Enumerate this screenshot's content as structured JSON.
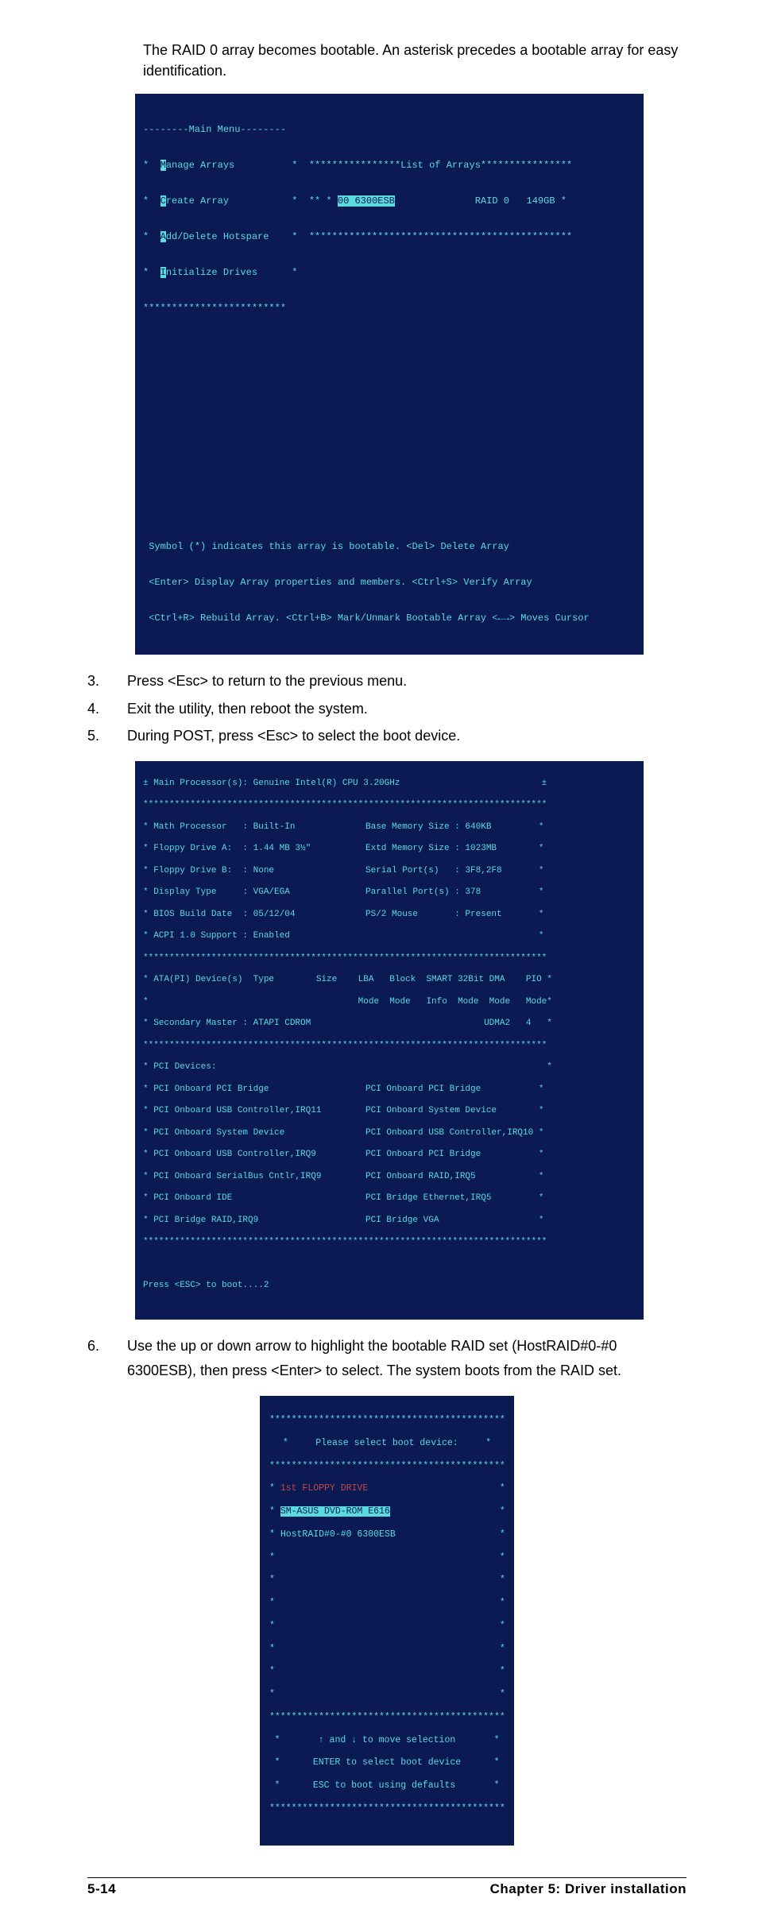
{
  "intro": "The RAID 0 array becomes bootable. An asterisk precedes a bootable array for easy identification.",
  "terminal1": {
    "menu_header": "--------Main Menu--------",
    "menu_items": [
      "anage Arrays",
      "reate Array",
      "dd/Delete Hotspare",
      "nitialize Drives"
    ],
    "menu_hl_chars": [
      "M",
      "C",
      "A",
      "I"
    ],
    "list_header": "****************List of Arrays****************",
    "list_row_prefix": "** * ",
    "list_row_id": "00 6300ESB",
    "list_row_type": "RAID 0",
    "list_row_size": "149GB",
    "list_row_suffix": " *",
    "hint1": "Symbol (*) indicates this array is bootable. <Del> Delete Array",
    "hint2": "<Enter> Display Array properties and members. <Ctrl+S> Verify Array",
    "hint3": "<Ctrl+R> Rebuild Array. <Ctrl+B> Mark/Unmark Bootable Array <←→> Moves Cursor"
  },
  "steps_a": [
    {
      "n": "3.",
      "t": "Press <Esc> to return to the previous menu."
    },
    {
      "n": "4.",
      "t": "Exit the utility, then reboot the system."
    },
    {
      "n": "5.",
      "t": "During POST, press <Esc> to select the boot device."
    }
  ],
  "terminal2": {
    "title": "± Main Processor(s): Genuine Intel(R) CPU 3.20GHz                           ±",
    "divider": "*****************************************************************************",
    "left1": [
      "* Math Processor   : Built-In",
      "* Floppy Drive A:  : 1.44 MB 3½\"",
      "* Floppy Drive B:  : None",
      "* Display Type     : VGA/EGA",
      "* BIOS Build Date  : 05/12/04",
      "* ACPI 1.0 Support : Enabled"
    ],
    "right1": [
      "Base Memory Size : 640KB         *",
      "Extd Memory Size : 1023MB        *",
      "Serial Port(s)   : 3F8,2F8       *",
      "Parallel Port(s) : 378           *",
      "PS/2 Mouse       : Present       *",
      "                                 *"
    ],
    "ata_header": "* ATA(PI) Device(s)  Type        Size    LBA   Block  SMART 32Bit DMA    PIO *",
    "ata_sub": "*                                        Mode  Mode   Info  Mode  Mode   Mode*",
    "ata_row": "* Secondary Master : ATAPI CDROM                                 UDMA2   4   *",
    "pci_header": "* PCI Devices:                                                               *",
    "pci_left": [
      "* PCI Onboard PCI Bridge",
      "* PCI Onboard USB Controller,IRQ11",
      "* PCI Onboard System Device",
      "* PCI Onboard USB Controller,IRQ9",
      "* PCI Onboard SerialBus Cntlr,IRQ9",
      "* PCI Onboard IDE",
      "* PCI Bridge RAID,IRQ9"
    ],
    "pci_right": [
      "PCI Onboard PCI Bridge           *",
      "PCI Onboard System Device        *",
      "PCI Onboard USB Controller,IRQ10 *",
      "PCI Onboard PCI Bridge           *",
      "PCI Onboard RAID,IRQ5            *",
      "PCI Bridge Ethernet,IRQ5         *",
      "PCI Bridge VGA                   *"
    ],
    "boot_line": "Press <ESC> to boot....2"
  },
  "steps_b": [
    {
      "n": "6.",
      "t": "Use the up or down arrow to highlight the bootable RAID set (HostRAID#0-#0 6300ESB), then press <Enter> to select. The system boots from the RAID set."
    }
  ],
  "terminal3": {
    "border": "*******************************************",
    "title": "Please select boot device:",
    "row_hl1": "1st FLOPPY DRIVE",
    "row_hl2": "SM-ASUS DVD-ROM E616",
    "row3": "HostRAID#0-#0 6300ESB",
    "hint1": "↑ and ↓ to move selection",
    "hint2": "ENTER to select boot device",
    "hint3": "ESC to boot using defaults"
  },
  "footer": {
    "left": "5-14",
    "right": "Chapter 5:  Driver installation"
  }
}
